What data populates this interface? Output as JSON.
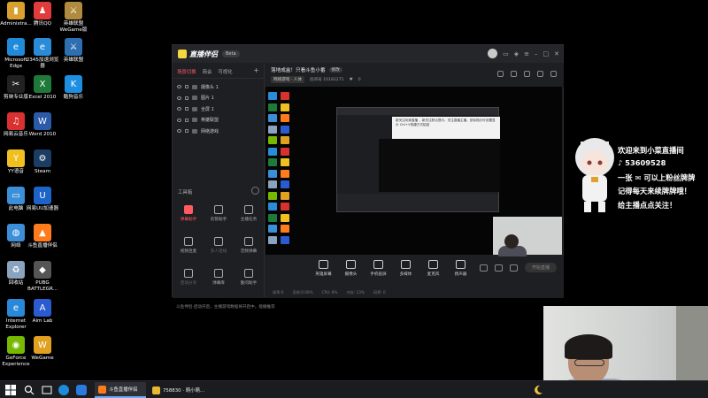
{
  "desktop": {
    "icons": [
      {
        "label": "Administra...",
        "icon": "user-folder-icon",
        "color": "#d9a030",
        "glyph": "▮"
      },
      {
        "label": "腾讯QQ",
        "icon": "qq-icon",
        "color": "#e23b3b",
        "glyph": "♟"
      },
      {
        "label": "英雄联盟 WeGame版",
        "icon": "lol-icon",
        "color": "#b08a3e",
        "glyph": "⚔"
      },
      {
        "label": "Microsoft Edge",
        "icon": "edge-icon",
        "color": "#1f8ad9",
        "glyph": "e"
      },
      {
        "label": "2345加速浏览器",
        "icon": "browser-2345-icon",
        "color": "#2a8bd8",
        "glyph": "e"
      },
      {
        "label": "英雄联盟",
        "icon": "lol-icon",
        "color": "#2d6fb0",
        "glyph": "⚔"
      },
      {
        "label": "剪映专业版",
        "icon": "capcut-icon",
        "color": "#222222",
        "glyph": "✂"
      },
      {
        "label": "Excel 2010",
        "icon": "excel-icon",
        "color": "#1f7a3a",
        "glyph": "X"
      },
      {
        "label": "酷狗音乐",
        "icon": "kugou-icon",
        "color": "#1e8fe0",
        "glyph": "K"
      },
      {
        "label": "网易云音乐",
        "icon": "netease-music-icon",
        "color": "#d93030",
        "glyph": "♫"
      },
      {
        "label": "Word 2010",
        "icon": "word-icon",
        "color": "#2b5aa8",
        "glyph": "W"
      },
      {
        "label": "YY语音",
        "icon": "yy-icon",
        "color": "#f0c020",
        "glyph": "Y"
      },
      {
        "label": "Steam",
        "icon": "steam-icon",
        "color": "#1b3c63",
        "glyph": "⚙"
      },
      {
        "label": "此电脑",
        "icon": "this-pc-icon",
        "color": "#3a8fd8",
        "glyph": "▭"
      },
      {
        "label": "网易UU加速器",
        "icon": "uu-icon",
        "color": "#1c64c8",
        "glyph": "U"
      },
      {
        "label": "网络",
        "icon": "network-icon",
        "color": "#3a8fd8",
        "glyph": "◍"
      },
      {
        "label": "斗鱼直播伴侣",
        "icon": "douyu-companion-icon",
        "color": "#ff7b1c",
        "glyph": "▲"
      },
      {
        "label": "回收站",
        "icon": "recycle-bin-icon",
        "color": "#8aa4c0",
        "glyph": "♻"
      },
      {
        "label": "PUBG BATTLEGR...",
        "icon": "pubg-icon",
        "color": "#555555",
        "glyph": "◆"
      },
      {
        "label": "Internet Explorer",
        "icon": "ie-icon",
        "color": "#2a88d8",
        "glyph": "e"
      },
      {
        "label": "Aim Lab",
        "icon": "aimlab-icon",
        "color": "#2a5bd0",
        "glyph": "A"
      },
      {
        "label": "GeForce Experience",
        "icon": "geforce-icon",
        "color": "#76b900",
        "glyph": "◉"
      },
      {
        "label": "WeGame",
        "icon": "wegame-icon",
        "color": "#e0a020",
        "glyph": "W"
      }
    ]
  },
  "app": {
    "title": "直播伴侣",
    "version_badge": "Beta",
    "left_tabs": [
      "场景切换",
      "简会",
      "可视化"
    ],
    "sources": [
      "摄像头 1",
      "图片 1",
      "全屏 1",
      "英雄联盟",
      "网络游戏"
    ],
    "toolbox_title": "工具箱",
    "tools": [
      {
        "label": "弹幕助手",
        "style": "red"
      },
      {
        "label": "房管助手",
        "style": ""
      },
      {
        "label": "主播任务",
        "style": ""
      },
      {
        "label": "视频连麦",
        "style": ""
      },
      {
        "label": "多人连线",
        "style": "dim"
      },
      {
        "label": "音频弹幕",
        "style": ""
      },
      {
        "label": "启动分享",
        "style": "dim"
      },
      {
        "label": "弹幕库",
        "style": ""
      },
      {
        "label": "勤问助手",
        "style": ""
      }
    ],
    "status_text": "斗鱼伴侣·启动开启，主播游戏数据将开启中，能播推荐",
    "stream": {
      "title": "落地成盒！只看斗鱼小番",
      "edit_label": "修改",
      "category": "网络游戏 · 人体",
      "room": "房间号 10181271",
      "likes": "0"
    },
    "controls": [
      {
        "label": "英雄屏幕",
        "icon": "screen-share-icon"
      },
      {
        "label": "摄像头",
        "icon": "camera-icon"
      },
      {
        "label": "手机投屏",
        "icon": "phone-cast-icon"
      },
      {
        "label": "多媒体",
        "icon": "media-icon"
      },
      {
        "label": "麦克风",
        "icon": "mic-icon"
      },
      {
        "label": "扬声器",
        "icon": "speaker-icon"
      }
    ],
    "start_live_label": "开始直播",
    "status_items": [
      "帧率:0",
      "丢帧:0.00%",
      "CPU: 8%",
      "内存: 13%",
      "码率: 0"
    ],
    "inner_tip": "新关注玩家直播 ，新关注获点提示，关注直播主播，鼠标指针可设置显示 Ctrl+V快捷方式粘贴"
  },
  "overlay": {
    "lines": [
      "欢迎来到小菜直播间",
      "♪ 53609528",
      "一张 ✉ 可以上粉丝牌牌",
      "记得每天来续牌牌哦！",
      "给主播点点关注！"
    ]
  },
  "taskbar": {
    "tasks": [
      {
        "label": "斗鱼直播伴侣",
        "icon": "douyu-companion-icon",
        "color": "#ff7b1c",
        "active": true
      },
      {
        "label": "758830 · 萌小萌...",
        "icon": "browser-icon",
        "color": "#e8b830",
        "active": false
      }
    ]
  }
}
